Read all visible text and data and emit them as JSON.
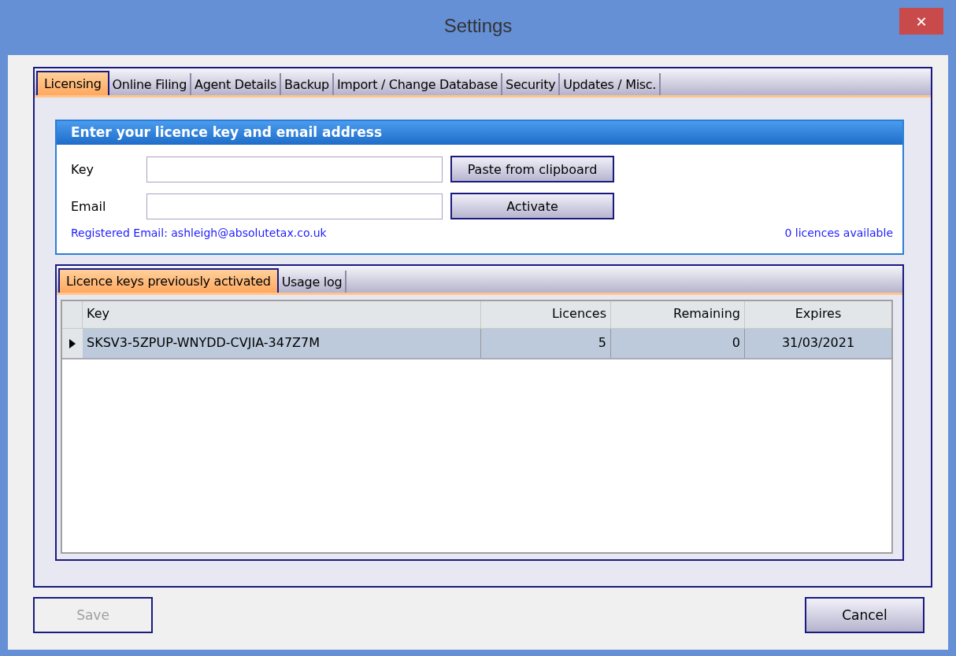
{
  "window": {
    "title": "Settings",
    "close": "✕"
  },
  "tabs": [
    {
      "label": "Licensing",
      "selected": true
    },
    {
      "label": "Online Filing",
      "selected": false
    },
    {
      "label": "Agent Details",
      "selected": false
    },
    {
      "label": "Backup",
      "selected": false
    },
    {
      "label": "Import / Change Database",
      "selected": false
    },
    {
      "label": "Security",
      "selected": false
    },
    {
      "label": "Updates / Misc.",
      "selected": false
    }
  ],
  "licence_panel": {
    "title": "Enter your licence key and email address",
    "fields": [
      {
        "label": "Key",
        "button": "Paste from clipboard"
      },
      {
        "label": "Email",
        "button": "Activate"
      }
    ],
    "registered_email": "Registered Email: ashleigh@absolutetax.co.uk",
    "licences_available": "0 licences available"
  },
  "sub_tabs": [
    {
      "label": "Licence keys previously activated",
      "selected": true
    },
    {
      "label": "Usage log",
      "selected": false
    }
  ],
  "table": {
    "columns": [
      "Key",
      "Licences",
      "Remaining",
      "Expires"
    ],
    "rows": [
      {
        "cells": [
          "SKSV3-5ZPUP-WNYDD-CVJIA-347Z7M",
          "5",
          "0",
          "31/03/2021"
        ],
        "selected": true
      }
    ]
  },
  "footer": [
    {
      "label": "Save",
      "disabled": true
    },
    {
      "label": "Cancel",
      "disabled": false
    }
  ]
}
